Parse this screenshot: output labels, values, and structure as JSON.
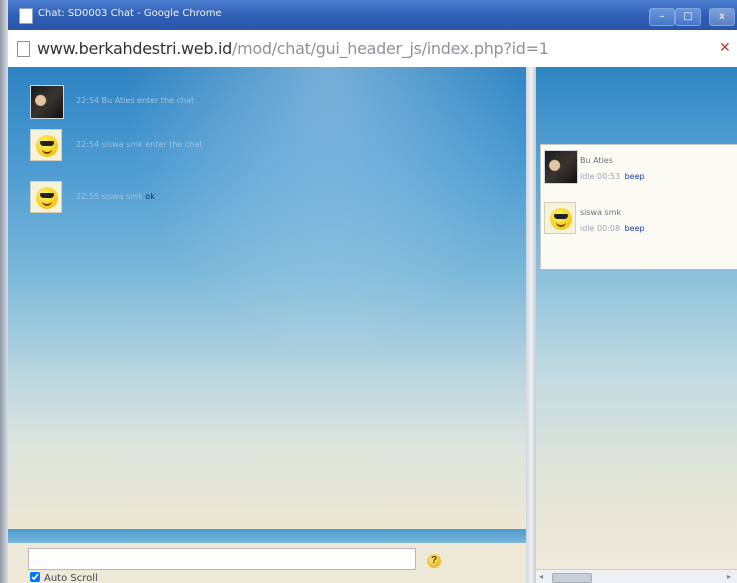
{
  "window": {
    "title": "Chat: SD0003 Chat - Google Chrome",
    "controls": {
      "minimize": "–",
      "maximize": "□",
      "close": "x"
    }
  },
  "address": {
    "domain": "www.berkahdestri.web.id",
    "path": "/mod/chat/gui_header_js/index.php?id=1"
  },
  "messages": [
    {
      "time": "22:54",
      "author": "Bu Aties",
      "text": "enter the chat",
      "avatar": "user-photo"
    },
    {
      "time": "22:54",
      "author": "siswa smk",
      "text": "enter the chat",
      "avatar": "smiley"
    },
    {
      "time": "22:55",
      "author": "siswa smk",
      "text": "ok",
      "avatar": "smiley"
    }
  ],
  "users": [
    {
      "name": "Bu Aties",
      "idle": "idle 00:53",
      "beep": "beep",
      "avatar": "user-photo"
    },
    {
      "name": "siswa smk",
      "idle": "idle 00:08",
      "beep": "beep",
      "avatar": "smiley"
    }
  ],
  "composer": {
    "value": "",
    "send_icon": "help-smiley-icon",
    "autoscroll_label": "Auto Scroll",
    "autoscroll_checked": true
  },
  "scrollbar": {
    "left_arrow": "◂",
    "right_arrow": "▸"
  }
}
